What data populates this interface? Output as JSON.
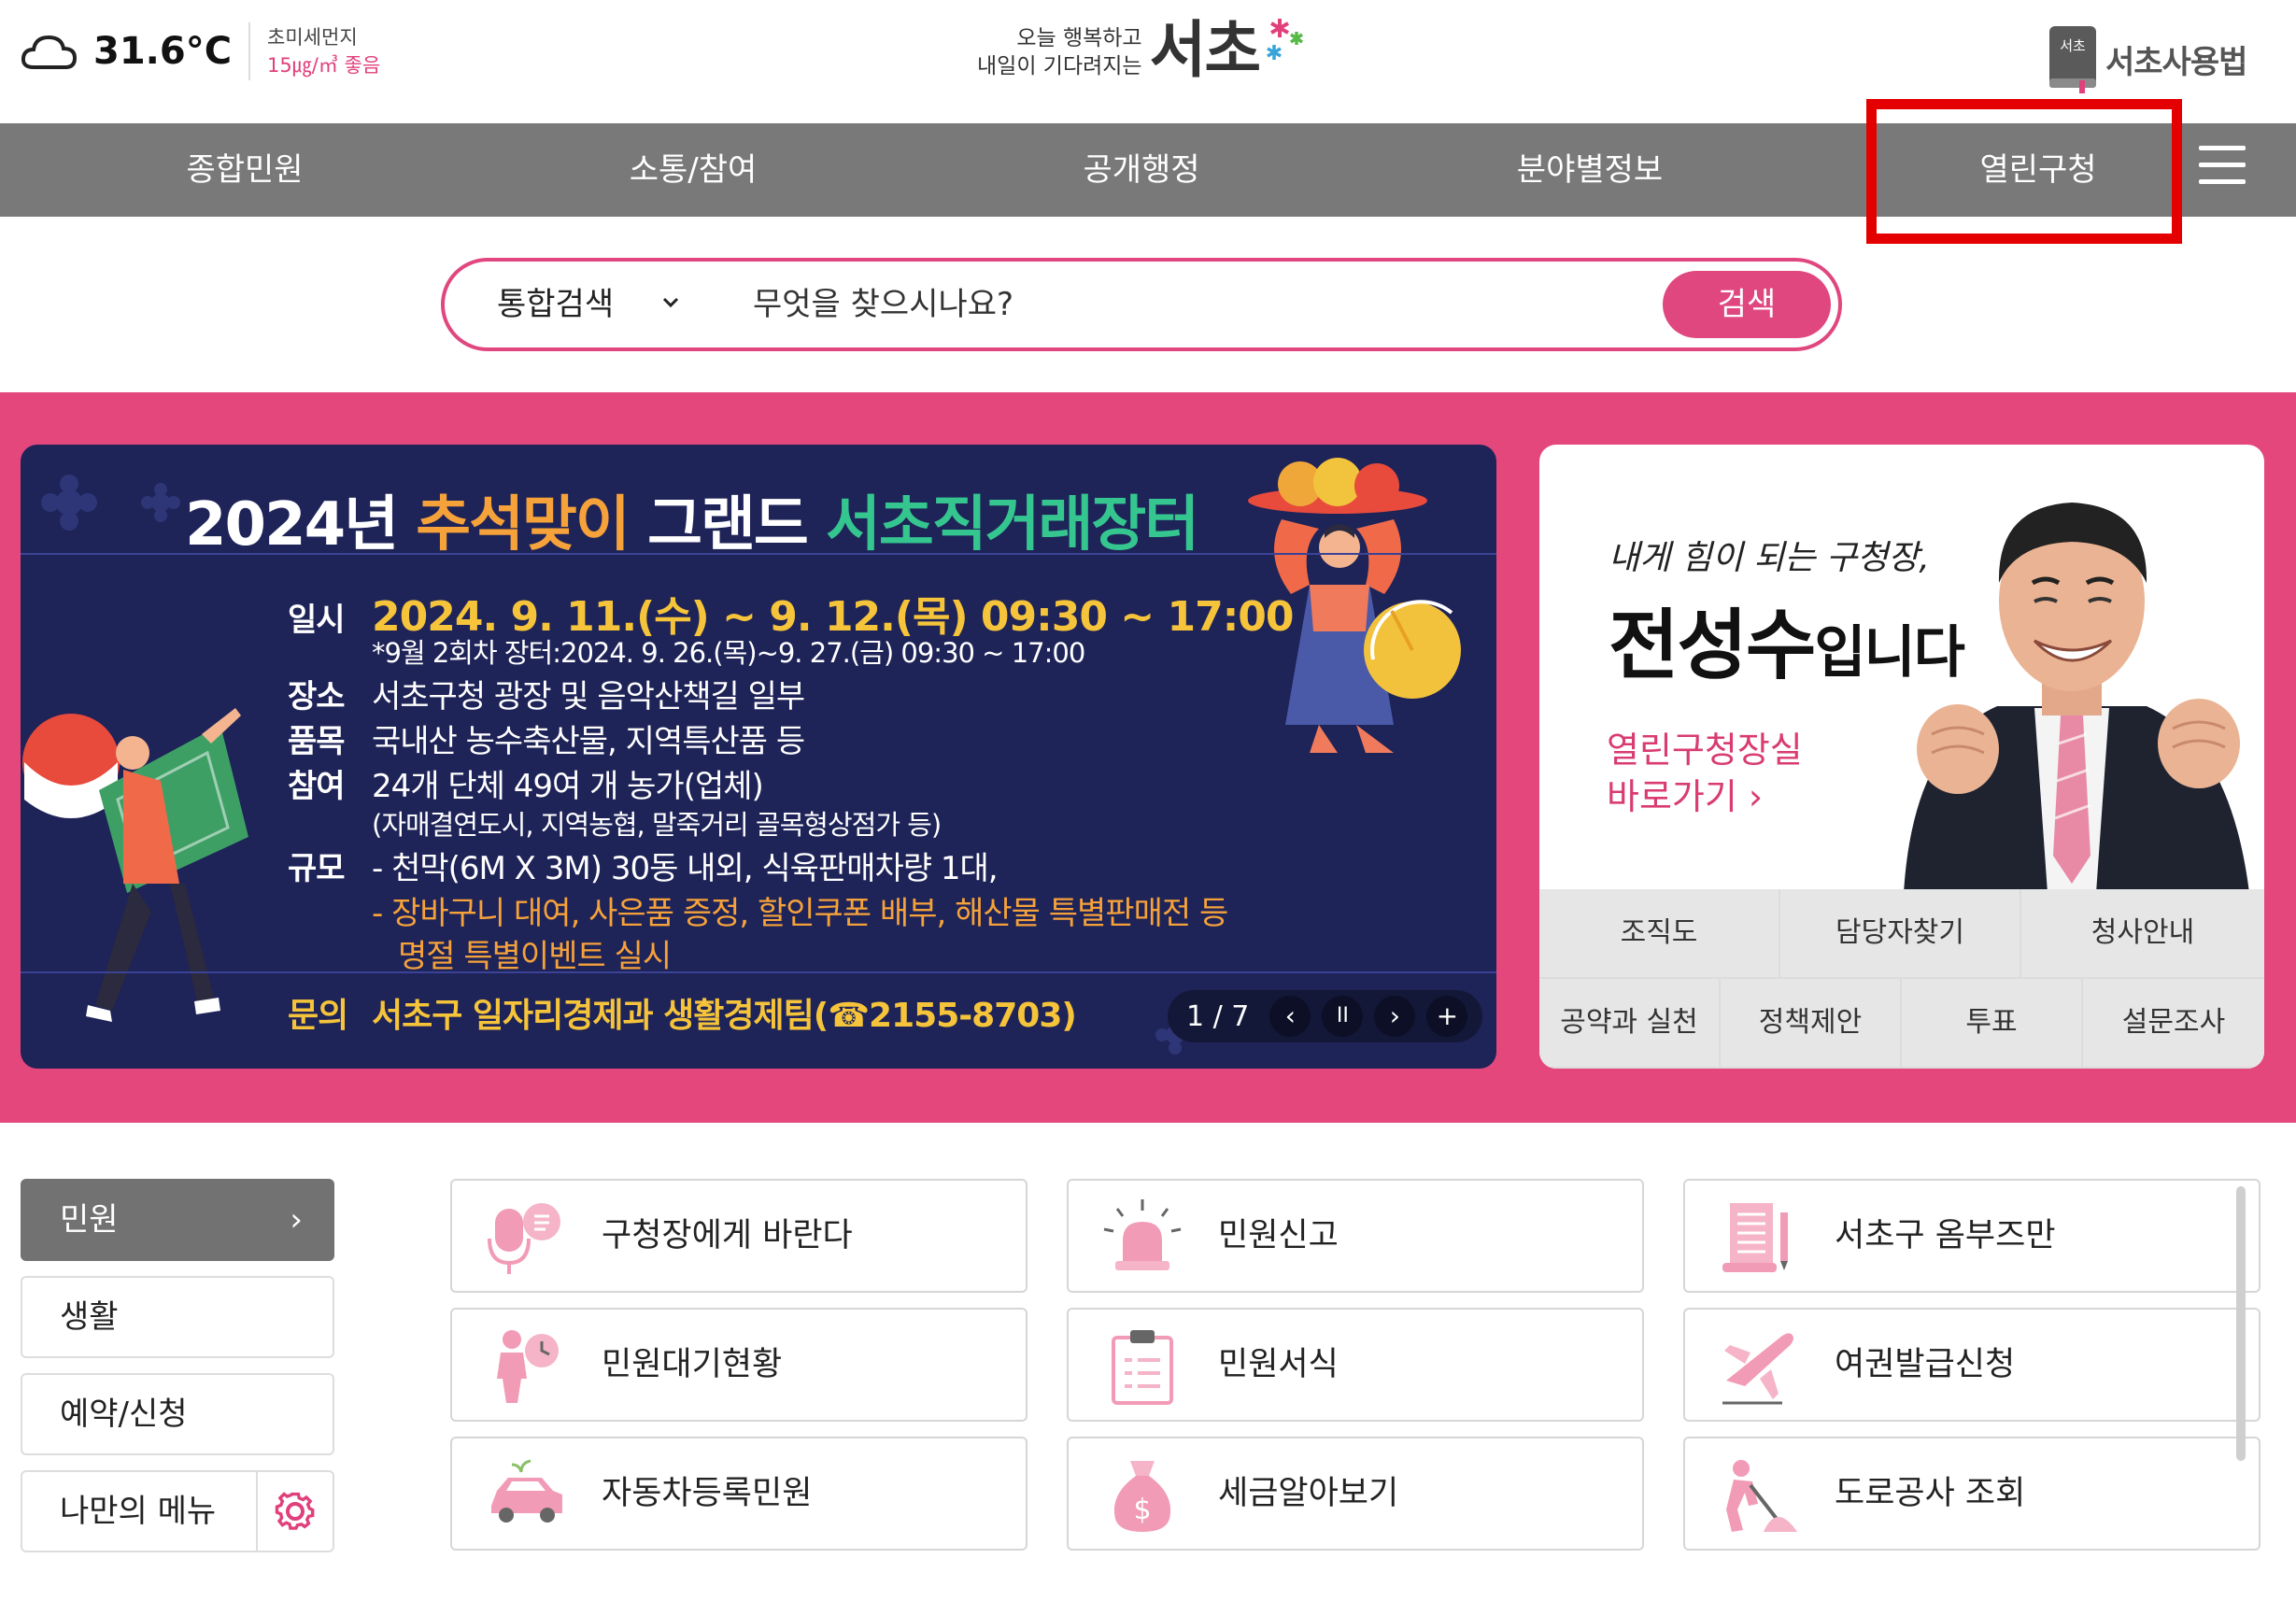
{
  "weather": {
    "temperature": "31.6°C",
    "dust_label": "초미세먼지",
    "dust_value": "15㎍/㎥ 좋음",
    "icon": "cloud-icon"
  },
  "logo": {
    "slogan_line1": "오늘 행복하고",
    "slogan_line2": "내일이 기다려지는",
    "brand": "서초",
    "dict_badge": "서초",
    "dict_text": "서초사용법"
  },
  "gnb": {
    "items": [
      "종합민원",
      "소통/참여",
      "공개행정",
      "분야별정보",
      "열린구청"
    ],
    "highlighted": "열린구청",
    "highlight_color": "#e40000"
  },
  "search": {
    "scope": "통합검색",
    "placeholder": "무엇을 찾으시나요?",
    "button": "검색"
  },
  "banner": {
    "title_part1": "2024년 ",
    "title_part2": "추석맞이",
    "title_part3": " 그랜드 ",
    "title_part4": "서초직거래장터",
    "date_label": "일시",
    "date_value": "2024. 9. 11.(수) ~ 9. 12.(목) 09:30 ~ 17:00",
    "date_note": "*9월 2회차 장터:2024. 9. 26.(목)~9. 27.(금) 09:30 ~ 17:00",
    "place_label": "장소",
    "place_value": "서초구청 광장 및 음악산책길 일부",
    "items_label": "품목",
    "items_value": "국내산 농수축산물, 지역특산품 등",
    "join_label": "참여",
    "join_value": "24개 단체 49여 개 농가(업체)",
    "join_note": "(자매결연도시, 지역농협, 말죽거리 골목형상점가 등)",
    "scale_label": "규모",
    "scale_value1": "- 천막(6M X 3M) 30동 내외, 식육판매차량 1대,",
    "scale_value2": "- 장바구니 대여, 사은품 증정, 할인쿠폰 배부, 해산물 특별판매전 등",
    "scale_value3": "명절 특별이벤트 실시",
    "contact_label": "문의",
    "contact_value": "서초구 일자리경제과 생활경제팀(☎2155-8703)",
    "page": "1 / 7",
    "ctrl_prev": "‹",
    "ctrl_pause": "II",
    "ctrl_next": "›",
    "ctrl_more": "+"
  },
  "mayor": {
    "slogan": "내게 힘이 되는 구청장,",
    "name": "전성수",
    "name_suffix": "입니다",
    "link_line1": "열린구청장실",
    "link_line2": "바로가기 ›",
    "row1": [
      "조직도",
      "담당자찾기",
      "청사안내"
    ],
    "row2": [
      "공약과 실천",
      "정책제안",
      "투표",
      "설문조사"
    ]
  },
  "side_tabs": {
    "t0": "민원",
    "t0_arrow": "›",
    "t1": "생활",
    "t2": "예약/신청",
    "t3": "나만의 메뉴"
  },
  "cards": [
    {
      "label": "구청장에게 바란다",
      "icon": "microphone-icon"
    },
    {
      "label": "민원신고",
      "icon": "siren-icon"
    },
    {
      "label": "서초구 옴부즈만",
      "icon": "document-icon"
    },
    {
      "label": "민원대기현황",
      "icon": "waiting-person-icon"
    },
    {
      "label": "민원서식",
      "icon": "clipboard-icon"
    },
    {
      "label": "여권발급신청",
      "icon": "airplane-icon"
    },
    {
      "label": "자동차등록민원",
      "icon": "car-icon"
    },
    {
      "label": "세금알아보기",
      "icon": "money-bag-icon"
    },
    {
      "label": "도로공사 조회",
      "icon": "road-work-icon"
    }
  ],
  "colors": {
    "accent": "#e3477c",
    "gnb_bg": "#797979",
    "banner_bg": "#1e2358",
    "icon_pink": "#f29bb6"
  }
}
